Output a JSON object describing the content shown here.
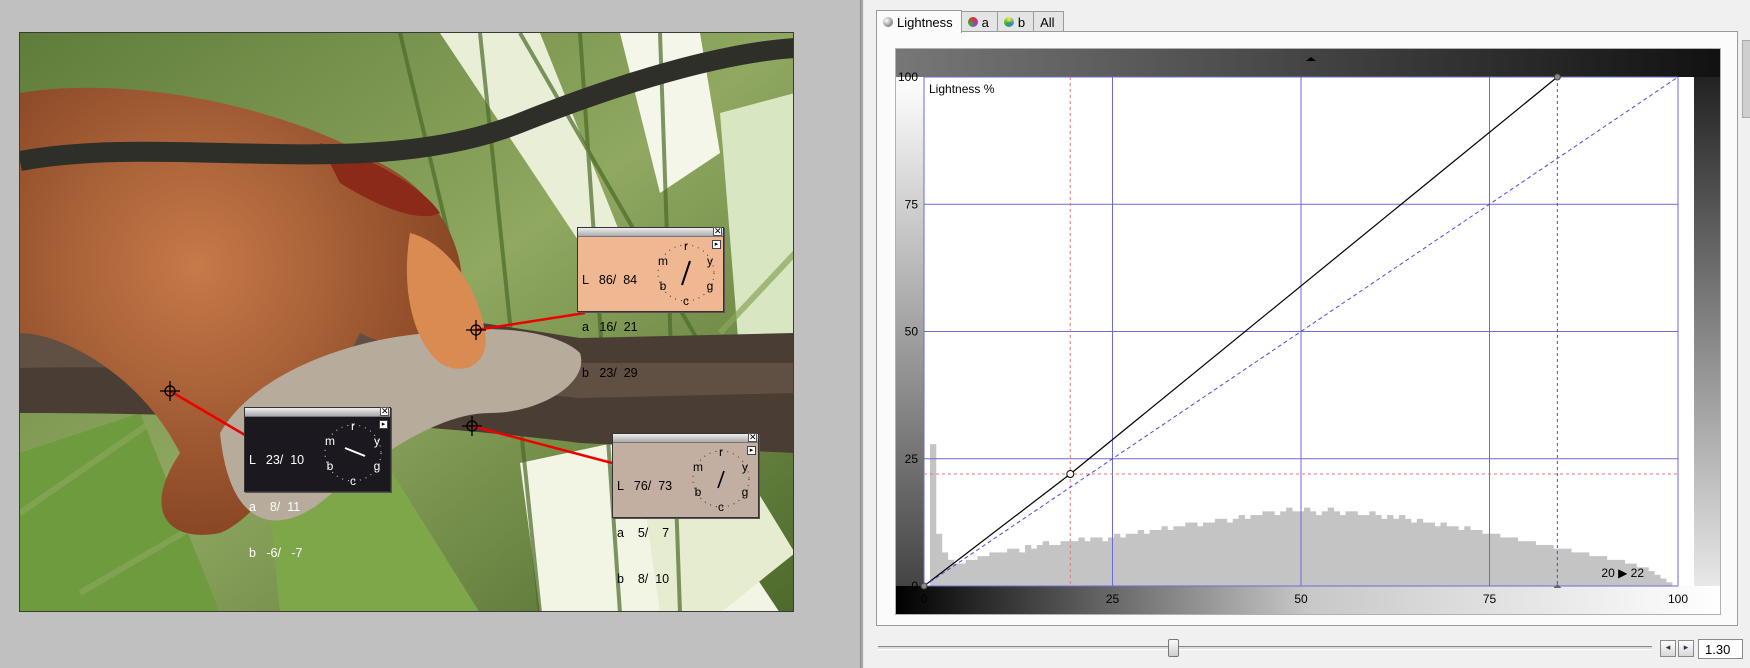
{
  "tabs": [
    {
      "label": "Lightness",
      "icon": "lightness-sphere-icon",
      "active": true
    },
    {
      "label": "a",
      "icon": "a-channel-sphere-icon",
      "active": false
    },
    {
      "label": "b",
      "icon": "b-channel-sphere-icon",
      "active": false
    },
    {
      "label": "All",
      "icon": "",
      "active": false
    }
  ],
  "probes": [
    {
      "id": "nose",
      "L": "L   86/  84",
      "a": "a   16/  21",
      "b": "b   23/  29",
      "background": "#f0b793",
      "clock_letters": [
        "r",
        "y",
        "g",
        "c",
        "b",
        "m"
      ],
      "close": "✕",
      "menu": "▸"
    },
    {
      "id": "branch",
      "L": "L   23/  10",
      "a": "a    8/  11",
      "b": "b   -6/   -7",
      "background": "#1c1820",
      "clock_letters": [
        "r",
        "y",
        "g",
        "c",
        "b",
        "m"
      ],
      "close": "✕",
      "menu": "▸"
    },
    {
      "id": "fur",
      "L": "L   76/  73",
      "a": "a    5/    7",
      "b": "b    8/  10",
      "background": "#c3aea2",
      "clock_letters": [
        "r",
        "y",
        "g",
        "c",
        "b",
        "m"
      ],
      "close": "✕",
      "menu": "▸"
    }
  ],
  "curve": {
    "title": "Lightness %",
    "readout": "20 ▶ 22"
  },
  "chart_data": {
    "type": "line",
    "title": "Lightness %",
    "xlim": [
      0,
      100
    ],
    "ylim": [
      0,
      100
    ],
    "x_ticks": [
      "0",
      "25",
      "50",
      "75",
      "100"
    ],
    "y_ticks": [
      "0",
      "25",
      "50",
      "75",
      "100"
    ],
    "grid": true,
    "series": [
      {
        "role": "curve",
        "x": [
          0,
          19.4,
          84
        ],
        "y": [
          0,
          22,
          100
        ]
      },
      {
        "role": "identity",
        "x": [
          0,
          100
        ],
        "y": [
          0,
          100
        ]
      }
    ],
    "control_point": {
      "x": 19.4,
      "y": 22
    },
    "black_point": 0,
    "white_point": 84,
    "guide_x": 19.4,
    "guide_y": 22,
    "histogram": [
      0,
      38,
      14,
      9,
      7,
      6,
      6,
      7,
      7,
      8,
      8,
      9,
      9,
      9,
      10,
      10,
      9,
      11,
      10,
      11,
      12,
      11,
      11,
      12,
      12,
      12,
      13,
      12,
      13,
      13,
      12,
      13,
      14,
      13,
      14,
      14,
      15,
      14,
      15,
      15,
      16,
      15,
      16,
      16,
      17,
      17,
      16,
      17,
      17,
      18,
      18,
      17,
      18,
      19,
      18,
      19,
      19,
      20,
      20,
      19,
      20,
      21,
      20,
      20,
      21,
      20,
      19,
      20,
      21,
      20,
      19,
      20,
      20,
      19,
      19,
      20,
      19,
      18,
      19,
      18,
      19,
      18,
      17,
      18,
      17,
      17,
      16,
      17,
      16,
      16,
      15,
      16,
      15,
      15,
      14,
      14,
      14,
      13,
      13,
      13,
      12,
      12,
      12,
      11,
      11,
      11,
      10,
      10,
      10,
      9,
      9,
      9,
      8,
      8,
      8,
      7,
      7,
      7,
      6,
      6,
      5,
      5,
      4,
      3,
      2,
      1,
      0
    ],
    "histogram_max": 45,
    "colors": {
      "grid": "#6b6bd8",
      "guide": "#e07a7a",
      "histogram": "#c4c4c4",
      "curve": "#000000",
      "identity": "#4a4ad6"
    }
  },
  "slider": {
    "value": 0.38
  },
  "zoom": {
    "value": "1.30",
    "left_arrow": "◂",
    "right_arrow": "▸"
  }
}
